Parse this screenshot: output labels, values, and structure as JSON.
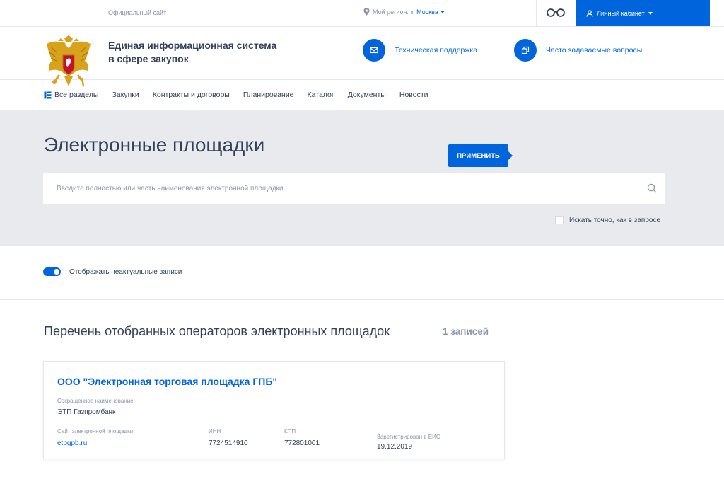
{
  "topbar": {
    "official_site": "Официальный сайт",
    "region_label": "Мой регион:",
    "region_value": "г. Москва",
    "cabinet_label": "Личный кабинет"
  },
  "header": {
    "title_line1": "Единая информационная система",
    "title_line2": "в сфере закупок",
    "support_label": "Техническая поддержка",
    "faq_label": "Часто задаваемые вопросы"
  },
  "nav": {
    "items": [
      "Все разделы",
      "Закупки",
      "Контракты и договоры",
      "Планирование",
      "Каталог",
      "Документы",
      "Новости"
    ]
  },
  "search": {
    "title": "Электронные площадки",
    "apply_label": "ПРИМЕНИТЬ",
    "placeholder": "Введите полностью или часть наименования электронной площадки",
    "value": "",
    "exact_label": "Искать точно, как в запросе"
  },
  "filter": {
    "toggle_label": "Отображать неактуальные записи",
    "toggle_on": true
  },
  "results": {
    "title": "Перечень отобранных операторов электронных площадок",
    "count": "1 записей",
    "items": [
      {
        "name": "ООО \"Электронная торговая площадка ГПБ\"",
        "short_name_label": "Сокращенное наименование",
        "short_name": "ЭТП Газпромбанк",
        "site_label": "Сайт электронной площадки",
        "site": "etpgpb.ru",
        "inn_label": "ИНН",
        "inn": "7724514910",
        "kpp_label": "КПП",
        "kpp": "772801001",
        "registered_label": "Зарегистрирован в ЕИС",
        "registered": "19.12.2019"
      }
    ]
  },
  "colors": {
    "accent": "#0065dd",
    "text": "#334059",
    "muted": "#8a94ab",
    "search_bg": "#e8eaee",
    "emblem_gold": "#d9a21b",
    "emblem_red": "#c8102e"
  },
  "icons": [
    "location-pin-icon",
    "glasses-icon",
    "user-icon",
    "envelope-icon",
    "copy-icon",
    "sections-icon",
    "search-icon",
    "emblem"
  ]
}
